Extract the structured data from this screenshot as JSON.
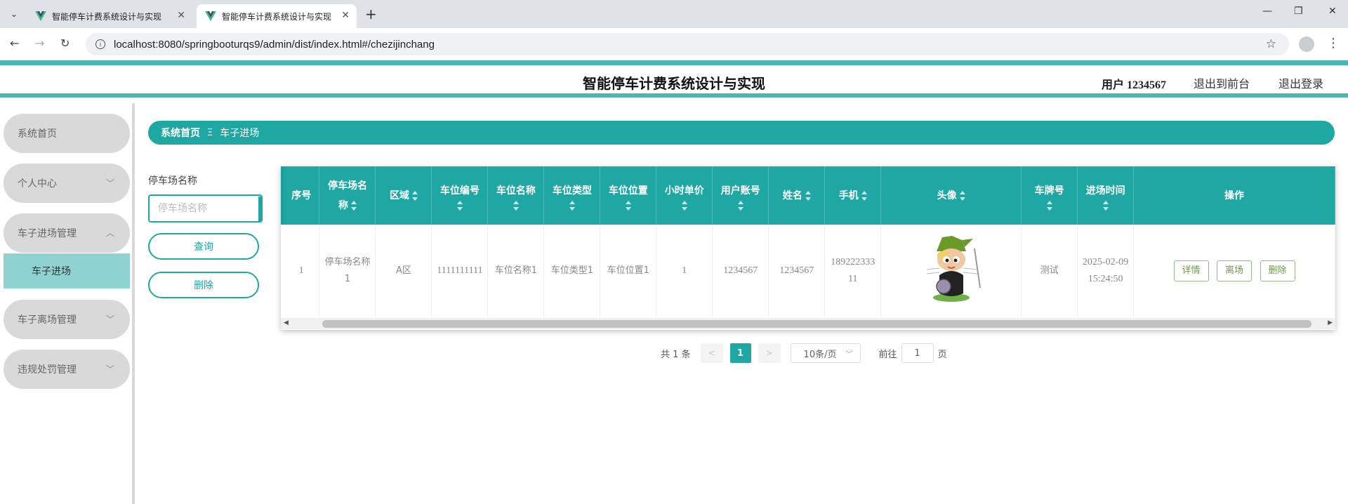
{
  "browser": {
    "tabs": [
      {
        "title": "智能停车计费系统设计与实现"
      },
      {
        "title": "智能停车计费系统设计与实现"
      }
    ],
    "url": "localhost:8080/springbooturqs9/admin/dist/index.html#/chezijinchang"
  },
  "header": {
    "title": "智能停车计费系统设计与实现",
    "user": "用户 1234567",
    "back_front": "退出到前台",
    "logout": "退出登录"
  },
  "sidebar": {
    "items": [
      {
        "label": "系统首页"
      },
      {
        "label": "个人中心"
      },
      {
        "label": "车子进场管理"
      },
      {
        "label": "车子离场管理"
      },
      {
        "label": "违规处罚管理"
      }
    ],
    "sub_item": "车子进场"
  },
  "breadcrumb": {
    "home": "系统首页",
    "separator": "Ξ",
    "current": "车子进场"
  },
  "filter": {
    "label": "停车场名称",
    "placeholder": "停车场名称",
    "query_btn": "查询",
    "delete_btn": "删除"
  },
  "table": {
    "headers": {
      "index": "序号",
      "lot_name_1": "停车场名",
      "lot_name_2": "称",
      "area": "区域",
      "space_no": "车位编号",
      "space_name": "车位名称",
      "space_type": "车位类型",
      "space_pos": "车位位置",
      "hour_price": "小时单价",
      "account": "用户账号",
      "name": "姓名",
      "phone": "手机",
      "avatar": "头像",
      "plate": "车牌号",
      "in_time": "进场时间",
      "ops": "操作"
    },
    "rows": [
      {
        "index": "1",
        "lot_name": "停车场名称1",
        "area": "A区",
        "space_no": "1111111111",
        "space_name": "车位名称1",
        "space_type": "车位类型1",
        "space_pos": "车位位置1",
        "hour_price": "1",
        "account": "1234567",
        "name": "1234567",
        "phone": "18922233311",
        "plate": "测试",
        "in_time": "2025-02-09 15:24:50",
        "detail_btn": "详情",
        "leave_btn": "离场",
        "delete_btn": "删除"
      }
    ]
  },
  "pagination": {
    "total": "共 1 条",
    "prev": "<",
    "page": "1",
    "next": ">",
    "page_size": "10条/页",
    "goto_label": "前往",
    "goto_value": "1",
    "goto_suffix": "页"
  },
  "colors": {
    "accent": "#1fa8a3",
    "sidebar_active": "#8fd3d0",
    "sidebar_item": "#d9d9d9"
  }
}
